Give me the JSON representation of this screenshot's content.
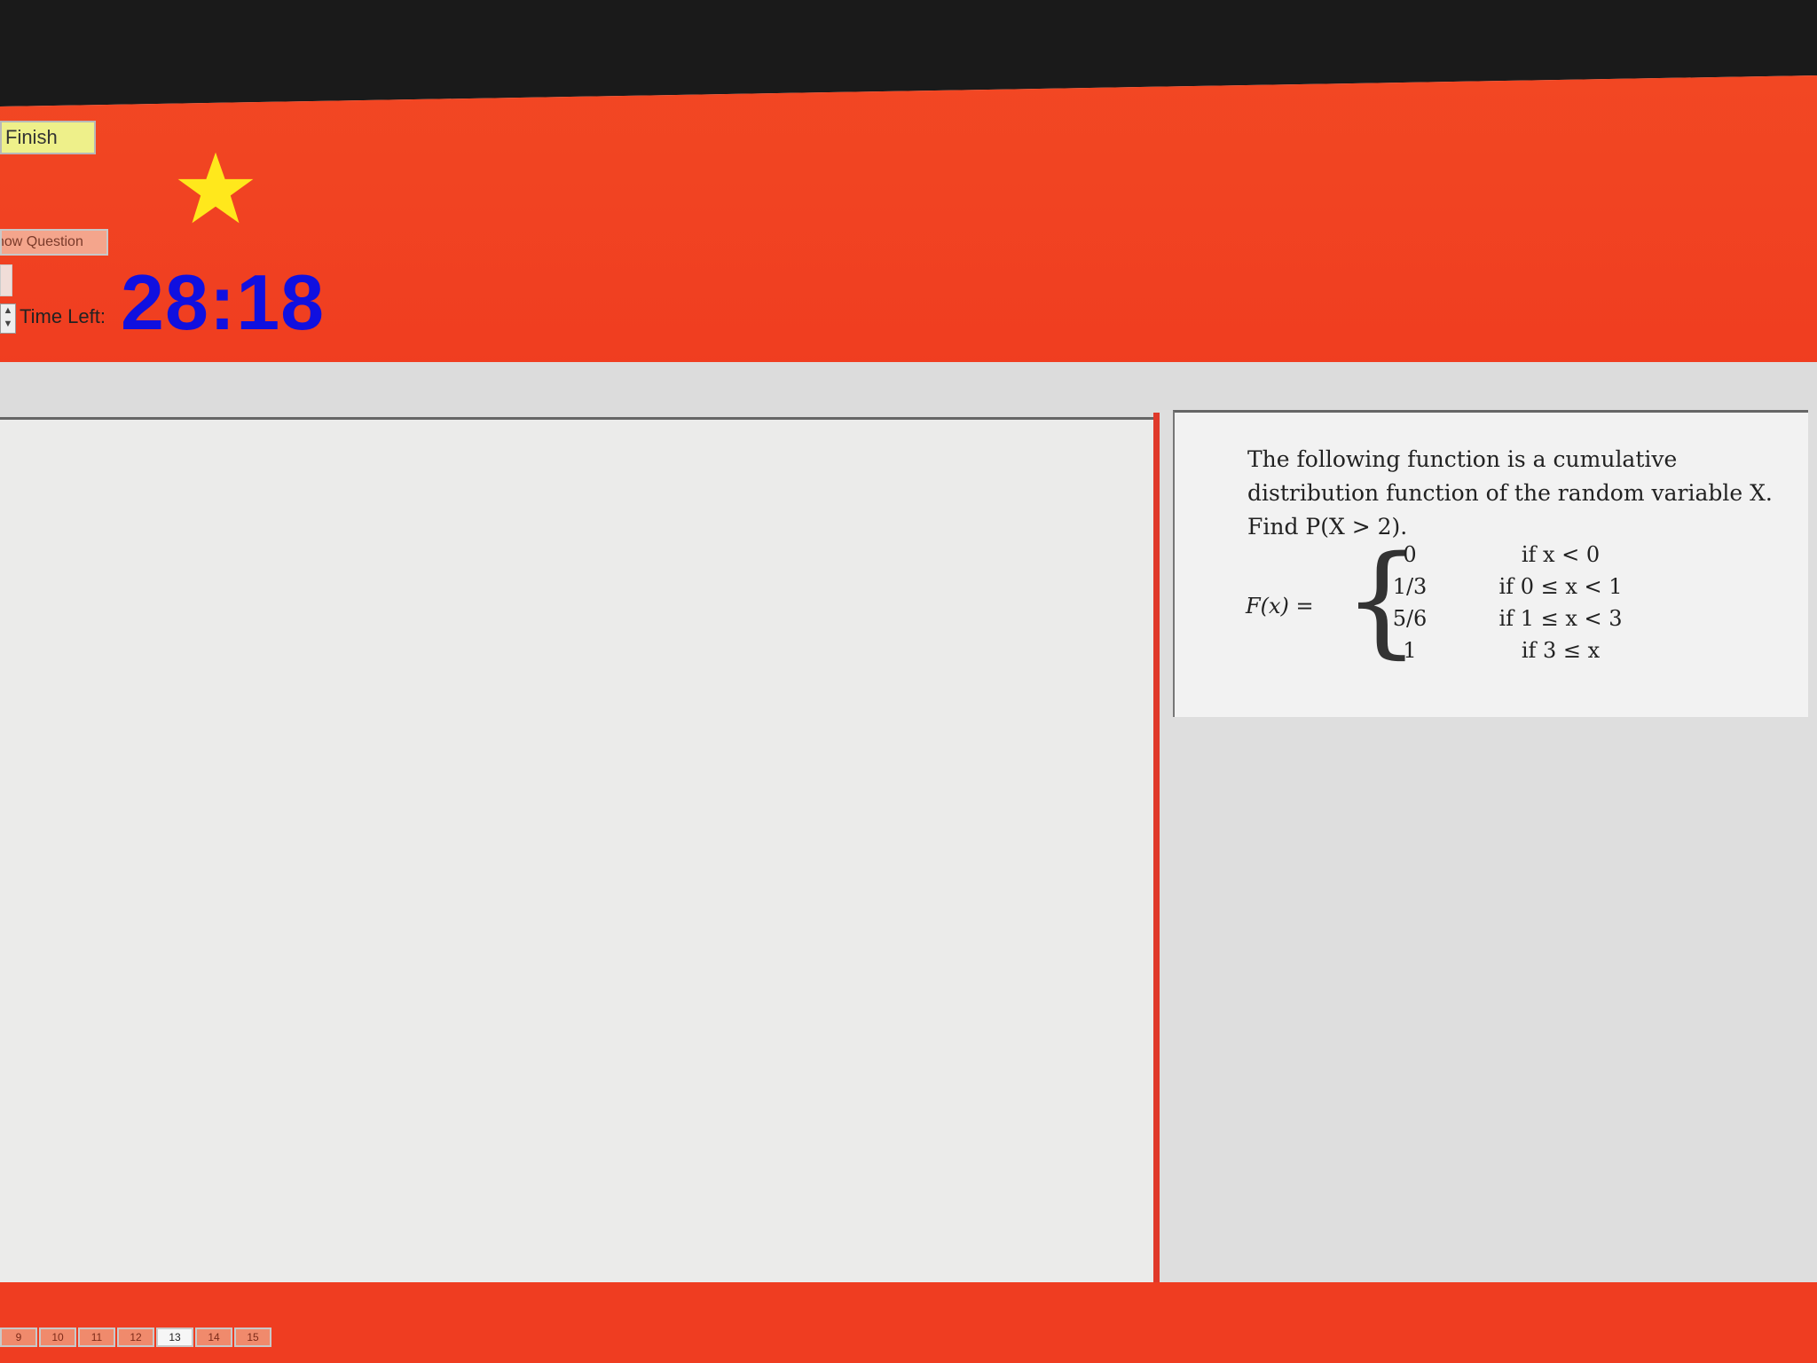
{
  "header": {
    "finish_label": "Finish",
    "show_question_label": "how Question",
    "time_left_label": "Time Left:",
    "time_value": "28:18",
    "star_icon": "star-icon",
    "colors": {
      "header_bg": "#f24a24",
      "timer": "#1010e0",
      "star": "#ffe81c"
    }
  },
  "question": {
    "text": "The following function is a cumulative distribution function of the random variable X. Find P(X > 2).",
    "fx_label": "F(x) =",
    "cases": [
      {
        "value": "0",
        "condition": "if x < 0"
      },
      {
        "value": "1/3",
        "condition": "if 0 ≤ x < 1"
      },
      {
        "value": "5/6",
        "condition": "if 1 ≤ x < 3"
      },
      {
        "value": "1",
        "condition": "if 3 ≤ x"
      }
    ]
  },
  "nav": {
    "items": [
      "9",
      "10",
      "11",
      "12",
      "13",
      "14",
      "15"
    ],
    "active_index": 4
  }
}
